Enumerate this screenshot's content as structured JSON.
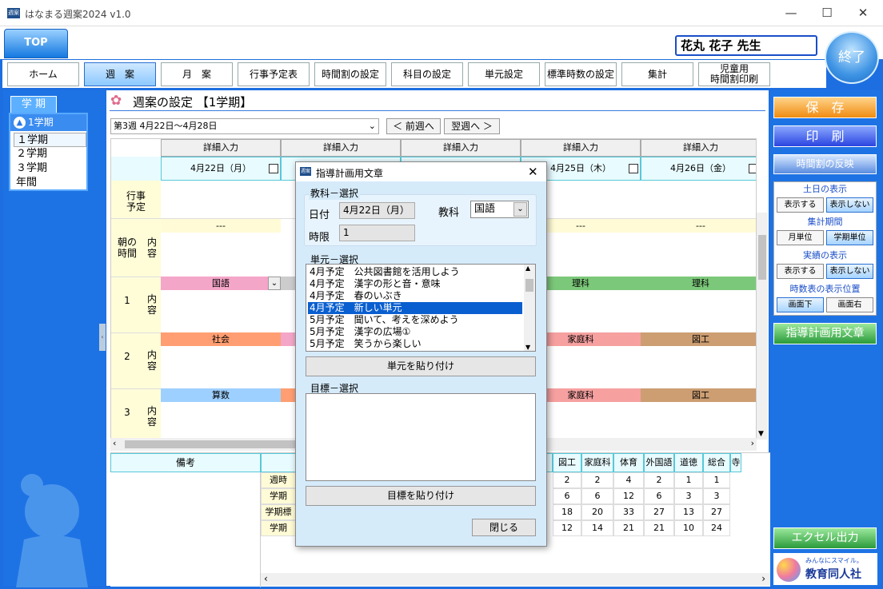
{
  "window": {
    "title": "はなまる週案2024 v1.0",
    "icon_label": "週案",
    "minimize": "—",
    "maximize": "☐",
    "close": "✕"
  },
  "top_tab": "TOP",
  "teacher_name": "花丸 花子 先生",
  "exit_label": "終了",
  "nav": [
    "ホーム",
    "週　案",
    "月　案",
    "行事予定表",
    "時間割の設定",
    "科目の設定",
    "単元設定",
    "標準時数の設定",
    "集計",
    "児童用\n時間割印刷"
  ],
  "left": {
    "tab": "学 期",
    "current": "1学期",
    "terms": [
      "１学期",
      "２学期",
      "３学期",
      "年間"
    ]
  },
  "page": {
    "title": "週案の設定 【1学期】",
    "week": "第3週 4月22日〜4月28日",
    "prev": "＜ 前週へ",
    "next": "翌週へ ＞"
  },
  "grid": {
    "detail_label": "詳細入力",
    "dates": [
      "4月22日（月）",
      "",
      "",
      "4月25日（木）",
      "4月26日（金）"
    ],
    "events_label": "行事\n予定",
    "morning_label": "朝の\n時間",
    "content_label": "内\n容",
    "dash": "---",
    "periods": [
      {
        "num": "1",
        "subjects": [
          "国語",
          "",
          "",
          "理科",
          "理科"
        ]
      },
      {
        "num": "2",
        "subjects": [
          "社会",
          "",
          "",
          "家庭科",
          "図工"
        ]
      },
      {
        "num": "3",
        "subjects": [
          "算数",
          "",
          "",
          "家庭科",
          "図工"
        ]
      }
    ]
  },
  "bottom": {
    "remarks": "備考",
    "row_labels": [
      "週時",
      "学期",
      "学期標",
      "学期"
    ],
    "subjects": [
      "図工",
      "家庭科",
      "体育",
      "外国語",
      "道徳",
      "総合",
      "寺"
    ],
    "rows": [
      [
        "2",
        "2",
        "4",
        "2",
        "1",
        "1"
      ],
      [
        "6",
        "6",
        "12",
        "6",
        "3",
        "3"
      ],
      [
        "18",
        "20",
        "33",
        "27",
        "13",
        "27"
      ],
      [
        "12",
        "14",
        "21",
        "21",
        "10",
        "24"
      ]
    ]
  },
  "right": {
    "save": "保　存",
    "print": "印　刷",
    "reflect": "時間割の反映",
    "groups": [
      {
        "label": "土日の表示",
        "buttons": [
          "表示する",
          "表示しない"
        ]
      },
      {
        "label": "集計期間",
        "buttons": [
          "月単位",
          "学期単位"
        ]
      },
      {
        "label": "実績の表示",
        "buttons": [
          "表示する",
          "表示しない"
        ]
      },
      {
        "label": "時数表の表示位置",
        "buttons": [
          "画面下",
          "画面右"
        ]
      }
    ],
    "guidance": "指導計画用文章",
    "excel": "エクセル出力",
    "logo_tag": "みんなにスマイル。",
    "logo": "教育同人社"
  },
  "dialog": {
    "title": "指導計画用文章",
    "close": "✕",
    "subject_section": "教科－選択",
    "date_label": "日付",
    "date_value": "4月22日（月）",
    "subject_label": "教科",
    "subject_value": "国語",
    "period_label": "時限",
    "period_value": "1",
    "unit_section": "単元－選択",
    "units": [
      "4月予定　公共図書館を活用しよう",
      "4月予定　漢字の形と音・意味",
      "4月予定　春のいぶき",
      "4月予定　新しい単元",
      "5月予定　聞いて、考えを深めよう",
      "5月予定　漢字の広場①",
      "5月予定　笑うから楽しい"
    ],
    "selected_unit": 3,
    "paste_unit": "単元を貼り付け",
    "goal_section": "目標－選択",
    "paste_goal": "目標を貼り付け",
    "close_btn": "閉じる"
  },
  "colors": {
    "kokugo": "#f4a6c8",
    "shakai": "#ff9e72",
    "sansu": "#9ed0ff",
    "rika": "#7cc87a",
    "katei": "#f6a0a0",
    "zuko": "#cc9e72",
    "blue": "#1d6ee0"
  }
}
